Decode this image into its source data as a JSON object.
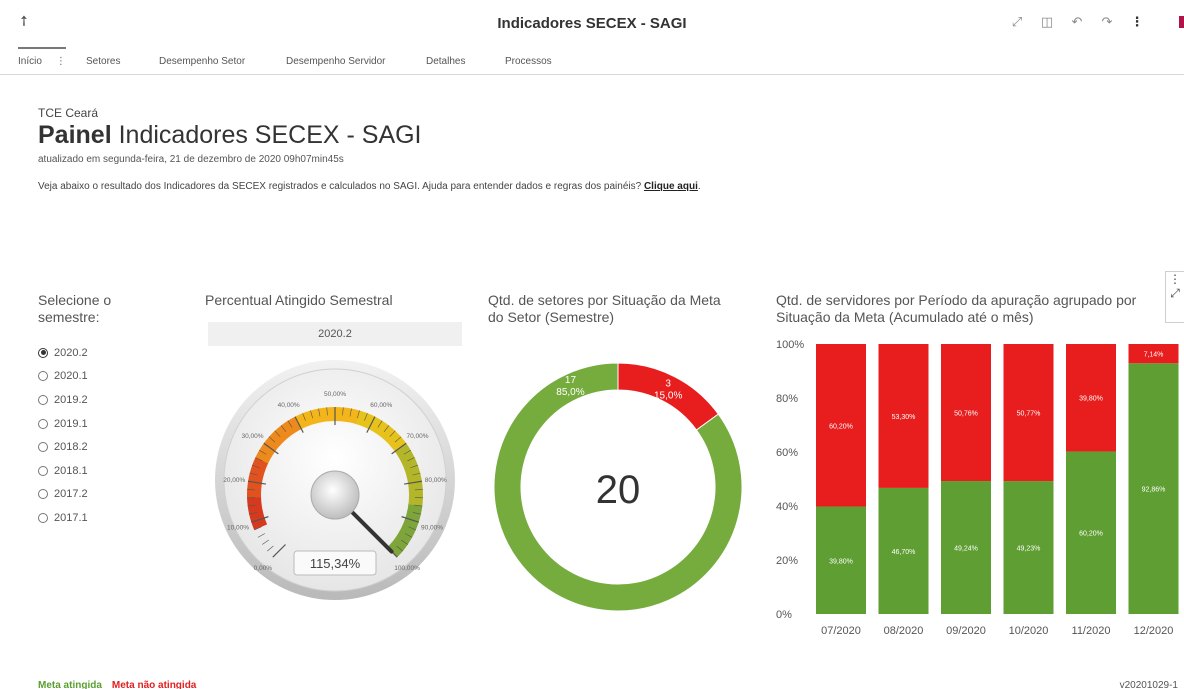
{
  "window": {
    "title": "Indicadores SECEX - SAGI",
    "toolbar_icons": [
      "pin-icon",
      "expand-icon",
      "split-view-icon",
      "undo-icon",
      "redo-icon",
      "more-icon"
    ]
  },
  "tabs": [
    {
      "label": "Início",
      "active": true
    },
    {
      "label": "Setores",
      "active": false
    },
    {
      "label": "Desempenho Setor",
      "active": false
    },
    {
      "label": "Desempenho Servidor",
      "active": false
    },
    {
      "label": "Detalhes",
      "active": false
    },
    {
      "label": "Processos",
      "active": false
    }
  ],
  "header": {
    "org": "TCE Ceará",
    "title_bold": "Painel",
    "title_rest": " Indicadores SECEX - SAGI",
    "updated": "atualizado em segunda-feira, 21 de dezembro de 2020 09h07min45s",
    "intro_text": "Veja abaixo o resultado dos Indicadores da SECEX registrados e calculados no SAGI. Ajuda para entender dados e regras dos painéis? ",
    "intro_link": "Clique aqui",
    "intro_end": "."
  },
  "semester_selector": {
    "title": "Selecione o semestre:",
    "options": [
      "2020.2",
      "2020.1",
      "2019.2",
      "2019.1",
      "2018.2",
      "2018.1",
      "2017.2",
      "2017.1"
    ],
    "selected": "2020.2"
  },
  "gauge": {
    "title": "Percentual Atingido Semestral",
    "semester": "2020.2",
    "value_label": "115,34%",
    "value_percent": 115.34,
    "scale_labels": [
      "0,00%",
      "10,00%",
      "20,00%",
      "30,00%",
      "40,00%",
      "50,00%",
      "60,00%",
      "70,00%",
      "80,00%",
      "90,00%",
      "100,00%"
    ]
  },
  "donut": {
    "title": "Qtd. de setores por Situação da Meta do Setor (Semestre)",
    "total": "20"
  },
  "bar_chart": {
    "title": "Qtd. de servidores por Período da apuração agrupado por Situação da Meta (Acumulado até o mês)"
  },
  "chart_data": [
    {
      "type": "gauge",
      "title": "Percentual Atingido Semestral",
      "value": 115.34,
      "value_label": "115,34%",
      "range": [
        0,
        100
      ],
      "tick_labels": [
        "0,00%",
        "10,00%",
        "20,00%",
        "30,00%",
        "40,00%",
        "50,00%",
        "60,00%",
        "70,00%",
        "80,00%",
        "90,00%",
        "100,00%"
      ]
    },
    {
      "type": "pie",
      "title": "Qtd. de setores por Situação da Meta do Setor (Semestre)",
      "center_label": "20",
      "slices": [
        {
          "name": "Meta não atingida",
          "value": 3,
          "percent_label": "15,0%",
          "color": "#e81e1e"
        },
        {
          "name": "Meta atingida",
          "value": 17,
          "percent_label": "85,0%",
          "color": "#76ac3e"
        }
      ]
    },
    {
      "type": "bar",
      "stacked": true,
      "title": "Qtd. de servidores por Período da apuração agrupado por Situação da Meta (Acumulado até o mês)",
      "categories": [
        "07/2020",
        "08/2020",
        "09/2020",
        "10/2020",
        "11/2020",
        "12/2020"
      ],
      "series": [
        {
          "name": "Meta atingida",
          "color": "#5e9e32",
          "values": [
            39.8,
            46.7,
            49.24,
            49.23,
            60.2,
            92.86
          ],
          "labels": [
            "39,80%",
            "46,70%",
            "49,24%",
            "49,23%",
            "60,20%",
            "92,86%"
          ]
        },
        {
          "name": "Meta não atingida",
          "color": "#e81e1e",
          "values": [
            60.2,
            53.3,
            50.76,
            50.77,
            39.8,
            7.14
          ],
          "labels": [
            "60,20%",
            "53,30%",
            "50,76%",
            "50,77%",
            "39,80%",
            "7,14%"
          ]
        }
      ],
      "ylim": [
        0,
        100
      ],
      "yticks": [
        "0%",
        "20%",
        "40%",
        "60%",
        "80%",
        "100%"
      ]
    }
  ],
  "footer": {
    "legend_ok": "Meta atingida",
    "legend_no": "Meta não atingida",
    "version": "v20201029-1"
  },
  "colors": {
    "ok": "#5e9e32",
    "no": "#e81e1e",
    "accent": "#b0124a"
  }
}
